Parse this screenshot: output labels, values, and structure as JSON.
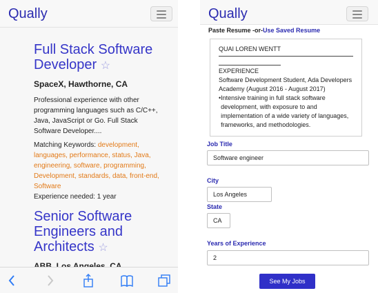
{
  "left": {
    "brand": "Qually",
    "jobs": [
      {
        "title": "Full Stack Software Developer",
        "company": "SpaceX, Hawthorne, CA",
        "description": "Professional experience with other programming languages such as C/C++, Java, JavaScript or Go. Full Stack Software Developer....",
        "keywords_label": "Matching Keywords:",
        "keywords": [
          "development,",
          "languages,",
          "performance,",
          "status,",
          "Java,",
          "engineering,",
          "software,",
          "programming,",
          "Development,",
          "standards,",
          "data,",
          "front-end,",
          "Software"
        ],
        "experience": "Experience needed: 1 year"
      },
      {
        "title": "Senior Software Engineers and Architects",
        "company": "ABB, Los Angeles, CA"
      }
    ],
    "star_glyph": "☆",
    "toolbar_icons": [
      "back-icon",
      "forward-icon",
      "share-icon",
      "bookmarks-icon",
      "tabs-icon"
    ]
  },
  "right": {
    "brand": "Qually",
    "paste_prefix": "Paste Resume -or-",
    "paste_link": "Use Saved Resume",
    "resume": {
      "name": "QUAI LOREN WENTT",
      "section": "EXPERIENCE",
      "role": "Software Development Student, Ada Developers Academy (August 2016 - August 2017)",
      "bullet": "Intensive training in full stack software development, with exposure to and implementation of a wide variety of languages, frameworks, and methodologies."
    },
    "job_title_label": "Job Title",
    "job_title_value": "Software engineer",
    "city_label": "City",
    "city_value": "Los Angeles",
    "state_label": "State",
    "state_value": "CA",
    "years_label": "Years of Experience",
    "years_value": "2",
    "submit_label": "See My Jobs"
  },
  "colors": {
    "brand": "#2b2bb0",
    "title_link": "#3535c8",
    "keyword": "#e27a18",
    "button": "#3030c8",
    "ios_blue": "#2f7cf6"
  }
}
